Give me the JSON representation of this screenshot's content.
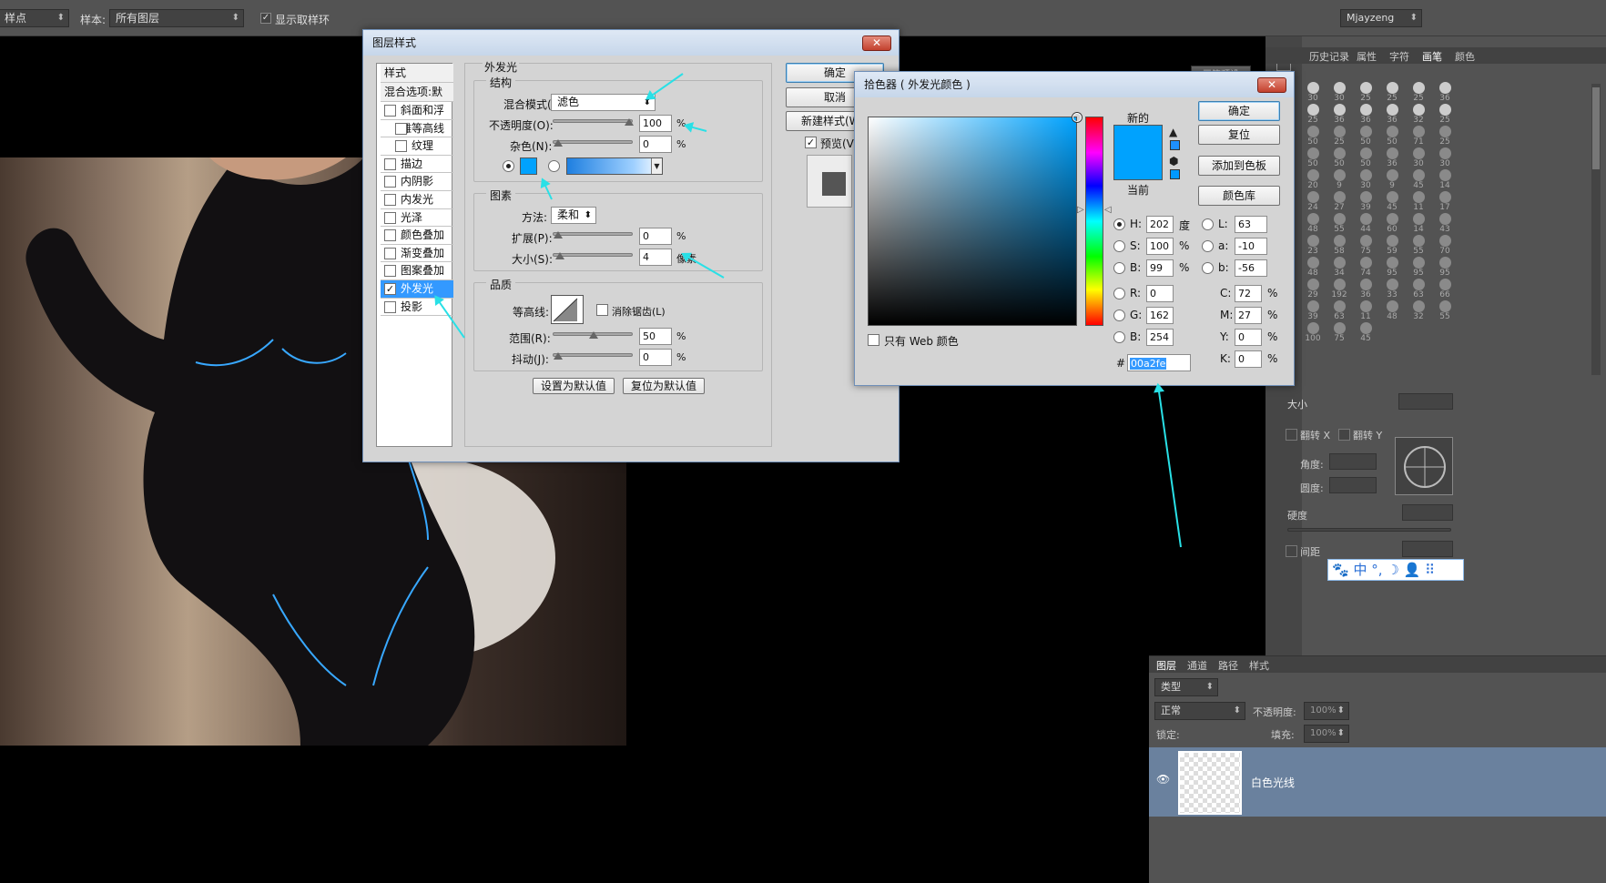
{
  "options_bar": {
    "tool_value": "样点",
    "sample_label": "样本:",
    "sample_value": "所有图层",
    "show_ring_label": "显示取样环",
    "workspace": "Mjayzeng"
  },
  "right_panel": {
    "tabs": [
      "历史记录",
      "属性",
      "字符",
      "画笔",
      "颜色"
    ],
    "preset_label": "画笔预设",
    "size_label": "大小",
    "flip_x": "翻转 X",
    "flip_y": "翻转 Y",
    "angle_label": "角度:",
    "roundness_label": "圆度:",
    "hardness_label": "硬度",
    "spacing_label": "间距",
    "brush_sizes": [
      "30",
      "30",
      "25",
      "25",
      "25",
      "36",
      "25",
      "36",
      "36",
      "36",
      "32",
      "25",
      "50",
      "25",
      "50",
      "50",
      "71",
      "25",
      "50",
      "50",
      "50",
      "36",
      "30",
      "30",
      "20",
      "9",
      "30",
      "9",
      "45",
      "14",
      "24",
      "27",
      "39",
      "45",
      "11",
      "17",
      "48",
      "55",
      "44",
      "60",
      "14",
      "43",
      "23",
      "58",
      "75",
      "59",
      "55",
      "70",
      "48",
      "34",
      "74",
      "95",
      "95",
      "95",
      "29",
      "192",
      "36",
      "33",
      "63",
      "66",
      "39",
      "63",
      "11",
      "48",
      "32",
      "55",
      "100",
      "75",
      "45"
    ]
  },
  "ime_bar": {
    "items": [
      "中",
      "°,",
      "☽",
      "👤",
      "⠿"
    ]
  },
  "layers_panel": {
    "tabs": [
      "图层",
      "通道",
      "路径",
      "样式"
    ],
    "filter": "类型",
    "blend": "正常",
    "opacity_label": "不透明度:",
    "opacity_value": "100%",
    "lock_label": "锁定:",
    "fill_label": "填充:",
    "fill_value": "100%",
    "layer_name": "白色光线"
  },
  "layer_style": {
    "title": "图层样式",
    "close": "✕",
    "list": [
      {
        "label": "样式",
        "type": "header"
      },
      {
        "label": "混合选项:默认",
        "type": "header"
      },
      {
        "label": "斜面和浮雕",
        "checked": false
      },
      {
        "label": "等高线",
        "checked": false,
        "indent": true
      },
      {
        "label": "纹理",
        "checked": false,
        "indent": true
      },
      {
        "label": "描边",
        "checked": false
      },
      {
        "label": "内阴影",
        "checked": false
      },
      {
        "label": "内发光",
        "checked": false
      },
      {
        "label": "光泽",
        "checked": false
      },
      {
        "label": "颜色叠加",
        "checked": false
      },
      {
        "label": "渐变叠加",
        "checked": false
      },
      {
        "label": "图案叠加",
        "checked": false
      },
      {
        "label": "外发光",
        "checked": true,
        "selected": true
      },
      {
        "label": "投影",
        "checked": false
      }
    ],
    "section_title": "外发光",
    "structure": {
      "title": "结构",
      "blend_label": "混合模式(E):",
      "blend_value": "滤色",
      "opacity_label": "不透明度(O):",
      "opacity_value": "100",
      "opacity_pct": 1.0,
      "noise_label": "杂色(N):",
      "noise_value": "0",
      "noise_pct": 0.0,
      "glow_color": "#00a2fe",
      "pct": "%"
    },
    "elements": {
      "title": "图素",
      "method_label": "方法:",
      "method_value": "柔和",
      "spread_label": "扩展(P):",
      "spread_value": "0",
      "spread_pct": 0.0,
      "size_label": "大小(S):",
      "size_value": "4",
      "size_pct": 0.02,
      "size_unit": "像素",
      "pct": "%"
    },
    "quality": {
      "title": "品质",
      "contour_label": "等高线:",
      "antialias_label": "消除锯齿(L)",
      "range_label": "范围(R):",
      "range_value": "50",
      "range_pct": 0.5,
      "jitter_label": "抖动(J):",
      "jitter_value": "0",
      "jitter_pct": 0.0,
      "pct": "%"
    },
    "set_default": "设置为默认值",
    "reset_default": "复位为默认值",
    "ok": "确定",
    "cancel": "取消",
    "new_style": "新建样式(W)...",
    "preview": "预览(V)"
  },
  "color_picker": {
    "title": "拾色器 ( 外发光颜色 )",
    "close": "✕",
    "new_label": "新的",
    "current_label": "当前",
    "new_color": "#00a2fe",
    "current_color": "#00a2fe",
    "ok": "确定",
    "reset": "复位",
    "add_swatch": "添加到色板",
    "color_lib": "颜色库",
    "web_only": "只有 Web 颜色",
    "hsb": [
      {
        "label": "H:",
        "value": "202",
        "unit": "度",
        "selected": true
      },
      {
        "label": "S:",
        "value": "100",
        "unit": "%"
      },
      {
        "label": "B:",
        "value": "99",
        "unit": "%"
      }
    ],
    "rgb": [
      {
        "label": "R:",
        "value": "0"
      },
      {
        "label": "G:",
        "value": "162"
      },
      {
        "label": "B:",
        "value": "254"
      }
    ],
    "lab": [
      {
        "label": "L:",
        "value": "63"
      },
      {
        "label": "a:",
        "value": "-10"
      },
      {
        "label": "b:",
        "value": "-56"
      }
    ],
    "cmyk": [
      {
        "label": "C:",
        "value": "72",
        "unit": "%"
      },
      {
        "label": "M:",
        "value": "27",
        "unit": "%"
      },
      {
        "label": "Y:",
        "value": "0",
        "unit": "%"
      },
      {
        "label": "K:",
        "value": "0",
        "unit": "%"
      }
    ],
    "hash": "#",
    "hex": "00a2fe",
    "hue_base": "#00a2fe"
  }
}
